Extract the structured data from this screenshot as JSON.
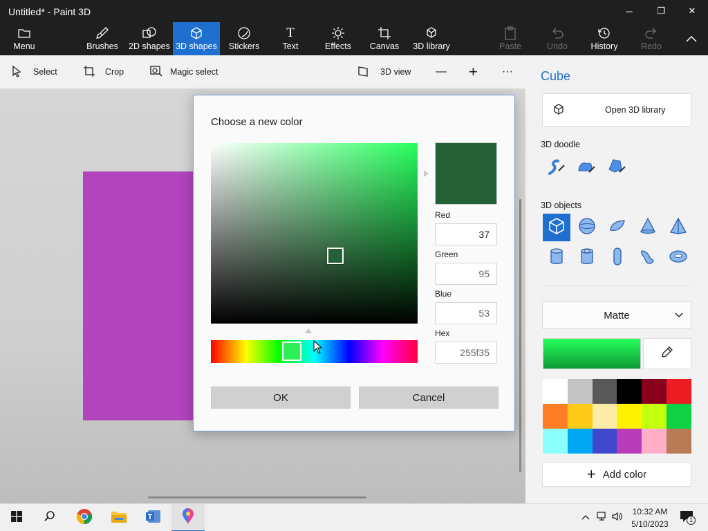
{
  "window": {
    "title": "Untitled* - Paint 3D",
    "minimize_glyph": "─",
    "restore_glyph": "❐",
    "close_glyph": "✕"
  },
  "ribbon": {
    "menu": "Menu",
    "tabs": [
      {
        "label": "Brushes",
        "icon": "brush-icon"
      },
      {
        "label": "2D shapes",
        "icon": "2d-shapes-icon"
      },
      {
        "label": "3D shapes",
        "icon": "3d-shapes-icon",
        "active": true
      },
      {
        "label": "Stickers",
        "icon": "stickers-icon"
      },
      {
        "label": "Text",
        "icon": "text-icon"
      },
      {
        "label": "Effects",
        "icon": "effects-icon"
      },
      {
        "label": "Canvas",
        "icon": "canvas-icon"
      },
      {
        "label": "3D library",
        "icon": "3d-library-icon"
      }
    ],
    "actions": [
      {
        "label": "Paste",
        "icon": "paste-icon",
        "disabled": true
      },
      {
        "label": "Undo",
        "icon": "undo-icon",
        "disabled": true
      },
      {
        "label": "History",
        "icon": "history-icon",
        "disabled": false
      },
      {
        "label": "Redo",
        "icon": "redo-icon",
        "disabled": true
      }
    ]
  },
  "toolbar": {
    "select": "Select",
    "crop": "Crop",
    "magic_select": "Magic select",
    "view_3d": "3D view",
    "zoom_out": "—",
    "zoom_in": "+",
    "more": "···"
  },
  "panel": {
    "title": "Cube",
    "open_library": "Open 3D library",
    "doodle_label": "3D doodle",
    "objects_label": "3D objects",
    "material": "Matte",
    "add_color": "Add color",
    "current_color": "#25ff5b",
    "palette": [
      "#ffffff",
      "#c3c3c3",
      "#585858",
      "#000000",
      "#88001b",
      "#ec1c24",
      "#ff7f27",
      "#ffca18",
      "#fdeca6",
      "#fff200",
      "#c4ff0e",
      "#0ed145",
      "#8cfffb",
      "#00a8f3",
      "#3f48cc",
      "#b83dba",
      "#ffaec8",
      "#b97a56"
    ]
  },
  "dialog": {
    "title": "Choose a new color",
    "red_label": "Red",
    "red_value": "37",
    "green_label": "Green",
    "green_value": "95",
    "blue_label": "Blue",
    "blue_value": "53",
    "hex_label": "Hex",
    "hex_value": "255f35",
    "ok": "OK",
    "cancel": "Cancel",
    "preview_color": "#255f35"
  },
  "taskbar": {
    "time": "10:32 AM",
    "date": "5/10/2023",
    "notification_count": "1"
  }
}
